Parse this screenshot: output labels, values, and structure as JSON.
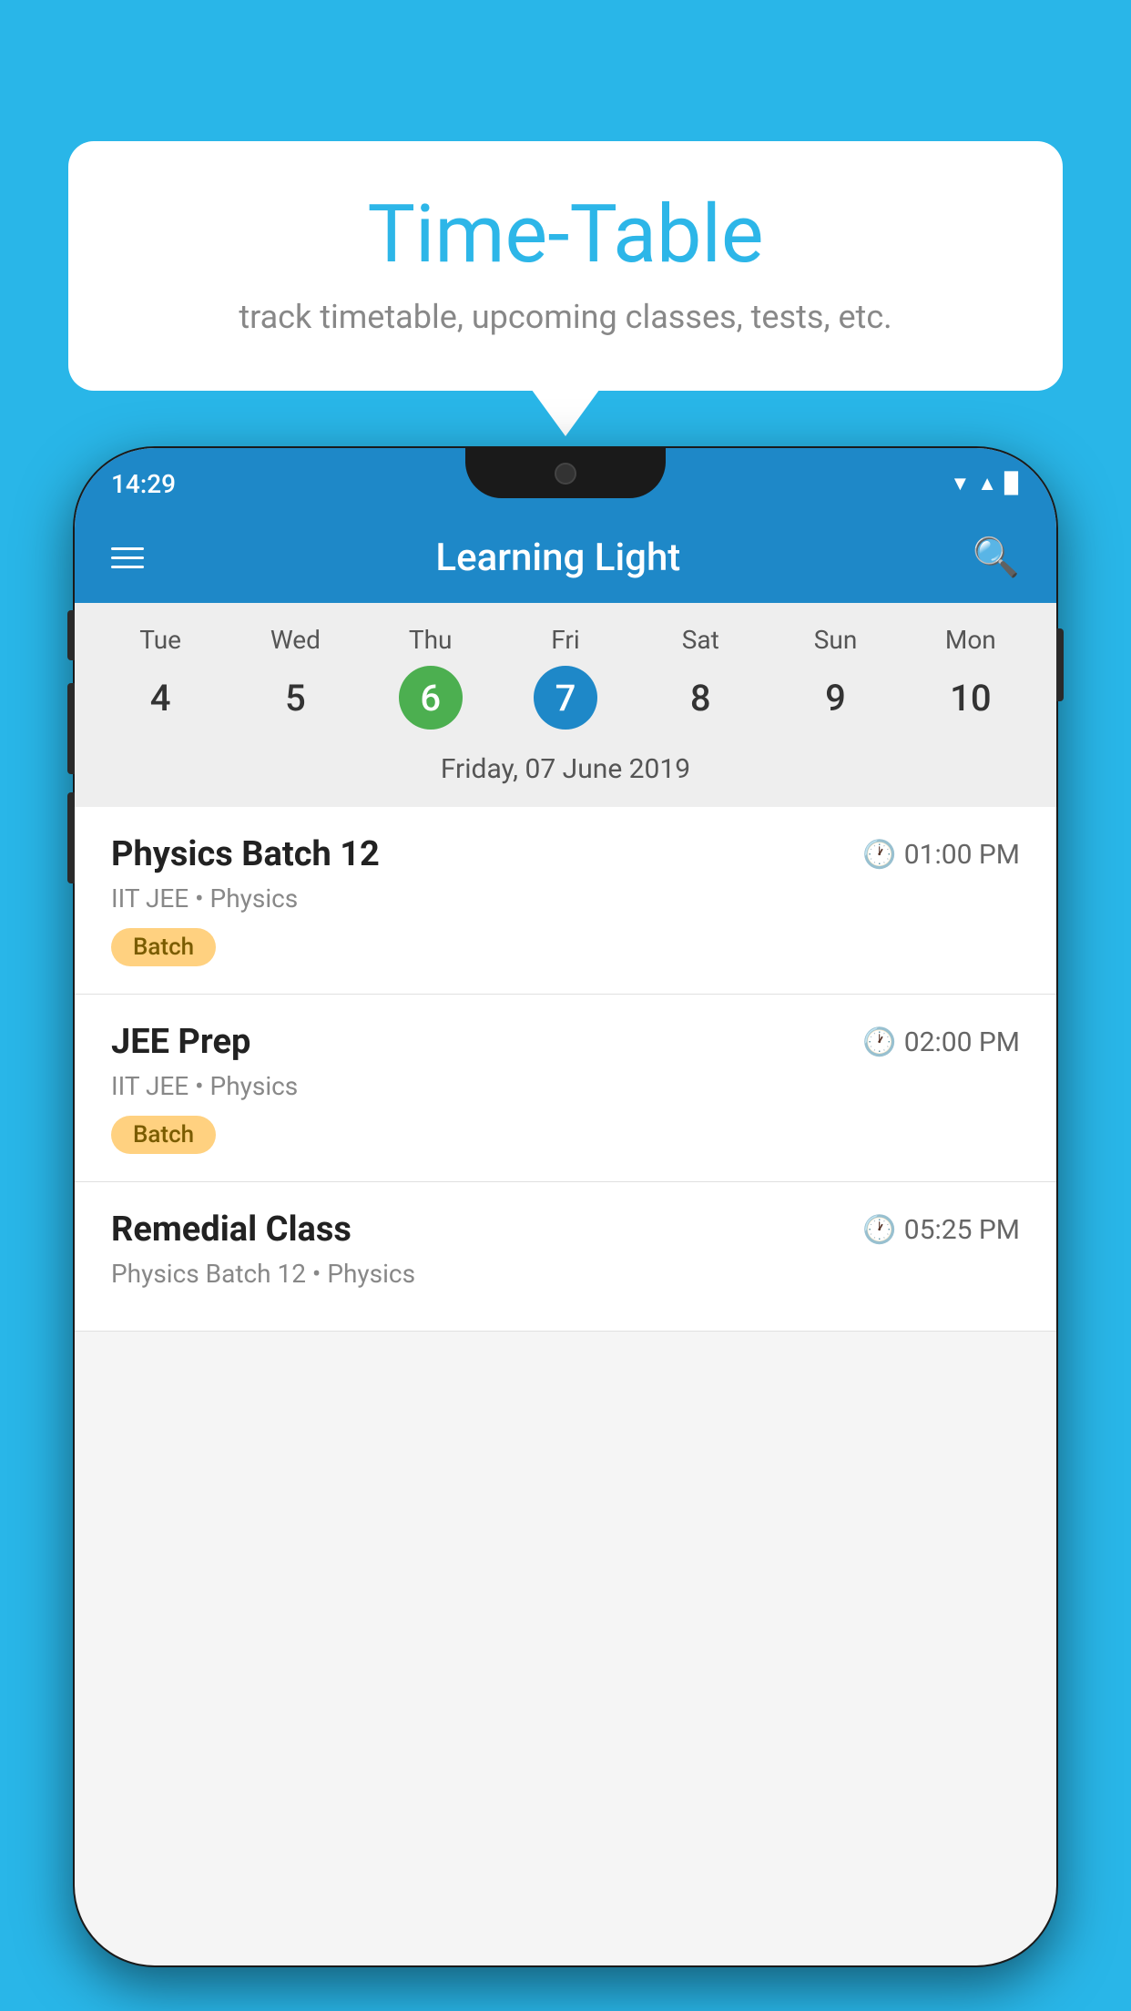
{
  "background_color": "#29b6e8",
  "speech_bubble": {
    "title": "Time-Table",
    "subtitle": "track timetable, upcoming classes, tests, etc."
  },
  "phone": {
    "status_bar": {
      "time": "14:29"
    },
    "app_bar": {
      "title": "Learning Light"
    },
    "calendar": {
      "days": [
        {
          "name": "Tue",
          "number": "4",
          "state": "normal"
        },
        {
          "name": "Wed",
          "number": "5",
          "state": "normal"
        },
        {
          "name": "Thu",
          "number": "6",
          "state": "today"
        },
        {
          "name": "Fri",
          "number": "7",
          "state": "selected"
        },
        {
          "name": "Sat",
          "number": "8",
          "state": "normal"
        },
        {
          "name": "Sun",
          "number": "9",
          "state": "normal"
        },
        {
          "name": "Mon",
          "number": "10",
          "state": "normal"
        }
      ],
      "selected_date": "Friday, 07 June 2019"
    },
    "classes": [
      {
        "name": "Physics Batch 12",
        "time": "01:00 PM",
        "subtitle": "IIT JEE • Physics",
        "badge": "Batch"
      },
      {
        "name": "JEE Prep",
        "time": "02:00 PM",
        "subtitle": "IIT JEE • Physics",
        "badge": "Batch"
      },
      {
        "name": "Remedial Class",
        "time": "05:25 PM",
        "subtitle": "Physics Batch 12 • Physics",
        "badge": null
      }
    ]
  }
}
